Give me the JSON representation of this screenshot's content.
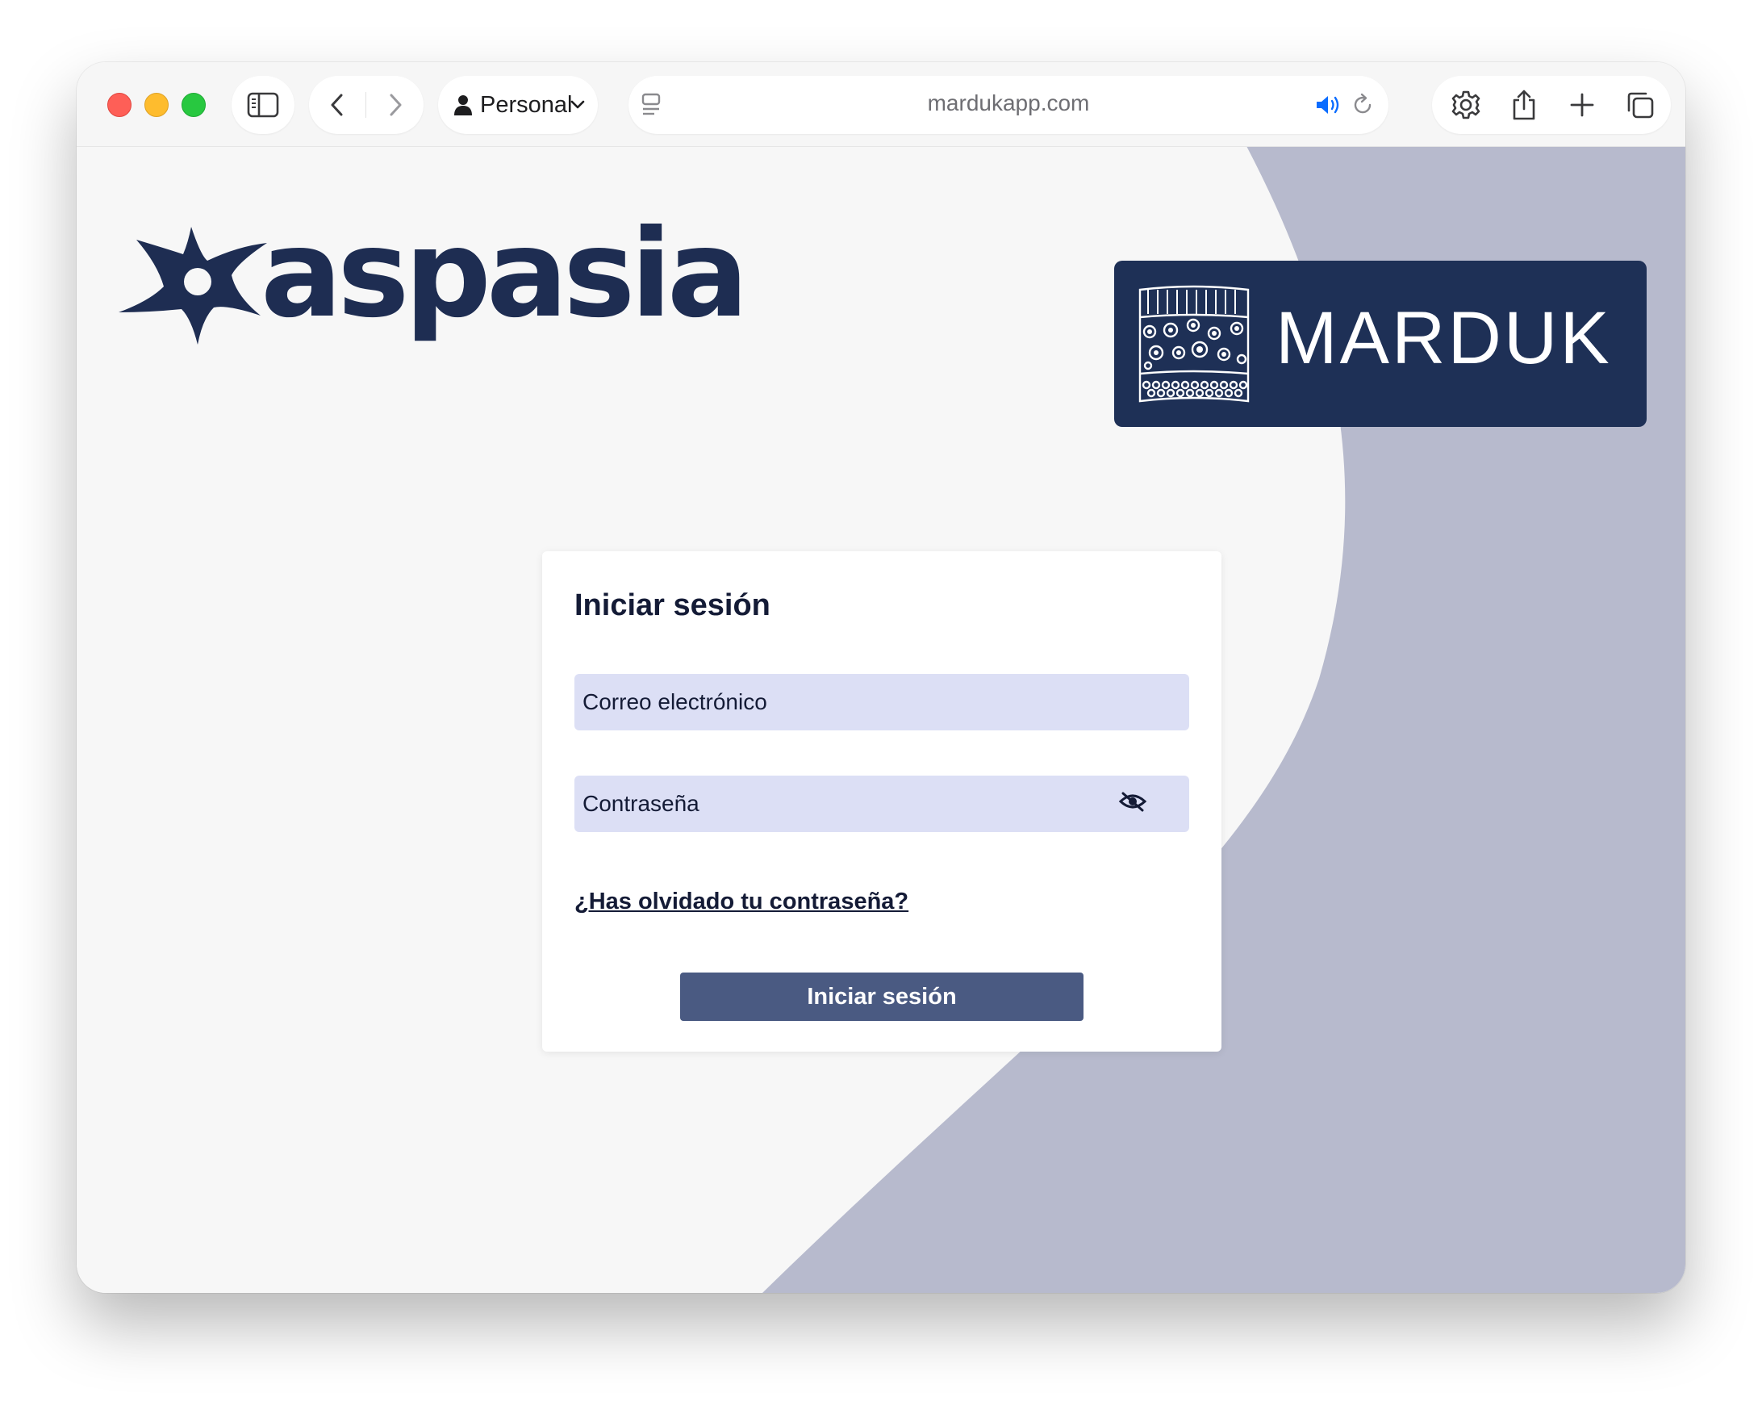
{
  "browser": {
    "profile_label": "Personal",
    "url": "mardukapp.com",
    "icons": [
      "sidebar-icon",
      "back-icon",
      "forward-icon",
      "person-icon",
      "chevron-down-icon",
      "reader-icon",
      "speaker-icon",
      "reload-icon",
      "gear-icon",
      "share-icon",
      "plus-icon",
      "tabs-icon"
    ]
  },
  "brand": {
    "aspasia": "aspasia",
    "marduk": "MARDUK"
  },
  "login": {
    "title": "Iniciar sesión",
    "email_placeholder": "Correo electrónico",
    "password_placeholder": "Contraseña",
    "forgot_link": "¿Has olvidado tu contraseña?",
    "submit_label": "Iniciar sesión"
  },
  "colors": {
    "brand_navy": "#1e3056",
    "button": "#4a5a82",
    "input_bg": "#dcdff5",
    "bg_shape": "#b7bacd",
    "accent_blue": "#0a6cff"
  }
}
